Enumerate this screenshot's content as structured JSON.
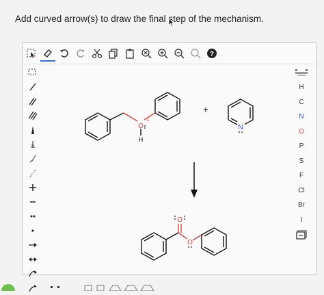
{
  "question": "Add curved arrow(s) to draw the final step of the mechanism.",
  "toolbar": {
    "items": [
      "select-tool",
      "eraser-tool",
      "undo",
      "redo",
      "cut",
      "copy",
      "paste",
      "zoom-fit",
      "zoom-in",
      "zoom-out",
      "zoom-reset",
      "help"
    ],
    "help_label": "?"
  },
  "left_tools": [
    "lasso",
    "single-bond",
    "double-bond",
    "triple-bond",
    "wedge-bond",
    "hash-bond",
    "wavy-bond",
    "dotted-bond",
    "charge-plus",
    "charge-minus",
    "lone-pair",
    "radical",
    "arrow-straight",
    "arrow-double",
    "arrow-curved",
    "arrow-half"
  ],
  "right_panel": {
    "elements": [
      "H",
      "C",
      "N",
      "O",
      "P",
      "S",
      "F",
      "Cl",
      "Br",
      "I"
    ],
    "periodic_table_label": "periodic-table",
    "template_label": "templates"
  },
  "molecules": {
    "reactant": {
      "name": "protonated benzyl phenyl ether",
      "o_label": "O",
      "h_label": "H",
      "plus_charge": "+"
    },
    "plus_sign": "+",
    "pyridine": {
      "n_label": "N"
    },
    "product": {
      "o_carbonyl": "O",
      "o_ester": "O"
    }
  },
  "colors": {
    "oxygen": "#d0453c",
    "nitrogen": "#2f4fd6",
    "bond": "#111111",
    "charge": "#d0453c"
  }
}
